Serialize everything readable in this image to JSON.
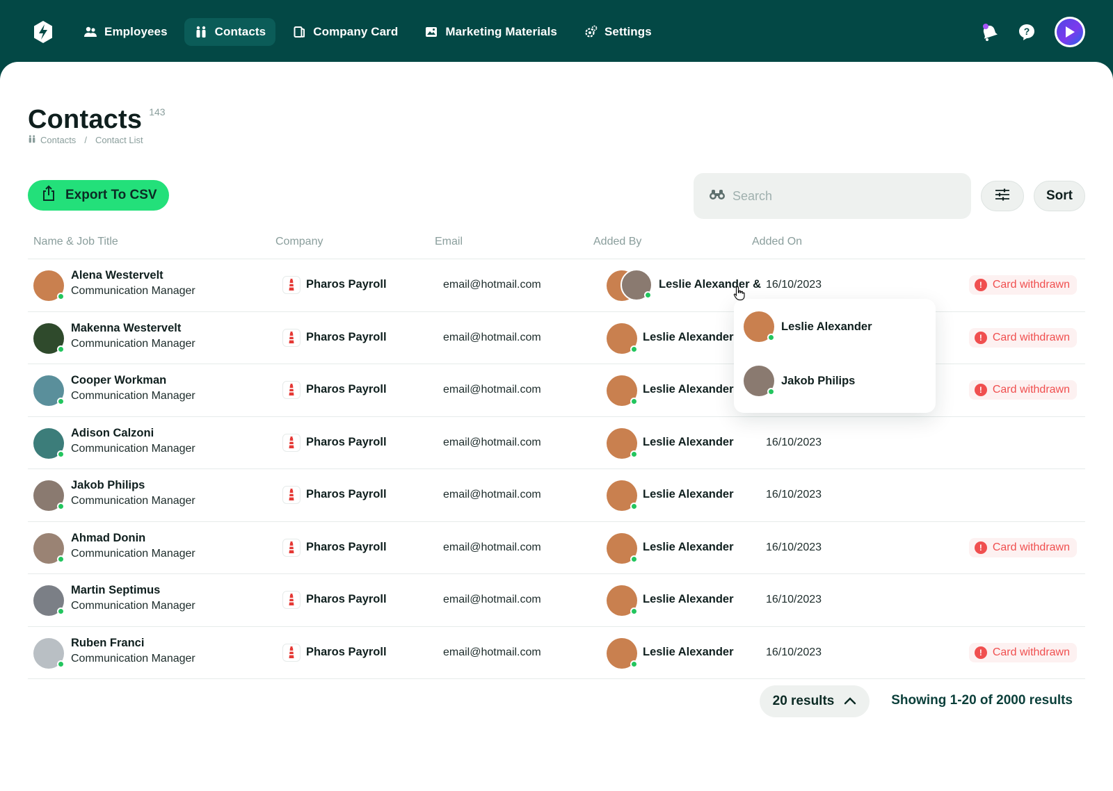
{
  "nav": {
    "items": [
      {
        "label": "Employees",
        "icon": "users-icon"
      },
      {
        "label": "Contacts",
        "icon": "contacts-icon",
        "active": true
      },
      {
        "label": "Company Card",
        "icon": "card-icon"
      },
      {
        "label": "Marketing Materials",
        "icon": "image-icon"
      },
      {
        "label": "Settings",
        "icon": "gear-icon"
      }
    ]
  },
  "header": {
    "title": "Contacts",
    "count": "143",
    "breadcrumb": [
      "Contacts",
      "Contact List"
    ]
  },
  "toolbar": {
    "export_label": "Export To CSV",
    "search_placeholder": "Search",
    "sort_label": "Sort"
  },
  "table": {
    "columns": [
      "Name & Job Title",
      "Company",
      "Email",
      "Added By",
      "Added On"
    ],
    "rows": [
      {
        "name": "Alena Westervelt",
        "job": "Communication Manager",
        "company": "Pharos Payroll",
        "email": "email@hotmail.com",
        "added_by": "Leslie Alexander &",
        "added_on": "16/10/2023",
        "status": "Card withdrawn",
        "avatar_color": "#c9804f"
      },
      {
        "name": "Makenna Westervelt",
        "job": "Communication Manager",
        "company": "Pharos Payroll",
        "email": "email@hotmail.com",
        "added_by": "Leslie Alexander",
        "added_on": "",
        "status": "Card withdrawn",
        "avatar_color": "#2f4a2c"
      },
      {
        "name": "Cooper Workman",
        "job": "Communication Manager",
        "company": "Pharos Payroll",
        "email": "email@hotmail.com",
        "added_by": "Leslie Alexander",
        "added_on": "",
        "status": "Card withdrawn",
        "avatar_color": "#5a8f9b"
      },
      {
        "name": "Adison Calzoni",
        "job": "Communication Manager",
        "company": "Pharos Payroll",
        "email": "email@hotmail.com",
        "added_by": "Leslie Alexander",
        "added_on": "16/10/2023",
        "status": "",
        "avatar_color": "#3c7d7a"
      },
      {
        "name": "Jakob Philips",
        "job": "Communication Manager",
        "company": "Pharos Payroll",
        "email": "email@hotmail.com",
        "added_by": "Leslie Alexander",
        "added_on": "16/10/2023",
        "status": "",
        "avatar_color": "#8a7a70"
      },
      {
        "name": "Ahmad Donin",
        "job": "Communication Manager",
        "company": "Pharos Payroll",
        "email": "email@hotmail.com",
        "added_by": "Leslie Alexander",
        "added_on": "16/10/2023",
        "status": "Card withdrawn",
        "avatar_color": "#9a8374"
      },
      {
        "name": "Martin Septimus",
        "job": "Communication Manager",
        "company": "Pharos Payroll",
        "email": "email@hotmail.com",
        "added_by": "Leslie Alexander",
        "added_on": "16/10/2023",
        "status": "",
        "avatar_color": "#7b7f86"
      },
      {
        "name": "Ruben Franci",
        "job": "Communication Manager",
        "company": "Pharos Payroll",
        "email": "email@hotmail.com",
        "added_by": "Leslie Alexander",
        "added_on": "16/10/2023",
        "status": "Card withdrawn",
        "avatar_color": "#b9bfc4"
      }
    ]
  },
  "popover": {
    "items": [
      "Leslie Alexander",
      "Jakob Philips"
    ]
  },
  "footer": {
    "results_label": "20 results",
    "showing_label": "Showing 1-20 of 2000 results"
  },
  "colors": {
    "brand": "#034845",
    "accent": "#23e07a",
    "danger": "#f04f4f"
  }
}
